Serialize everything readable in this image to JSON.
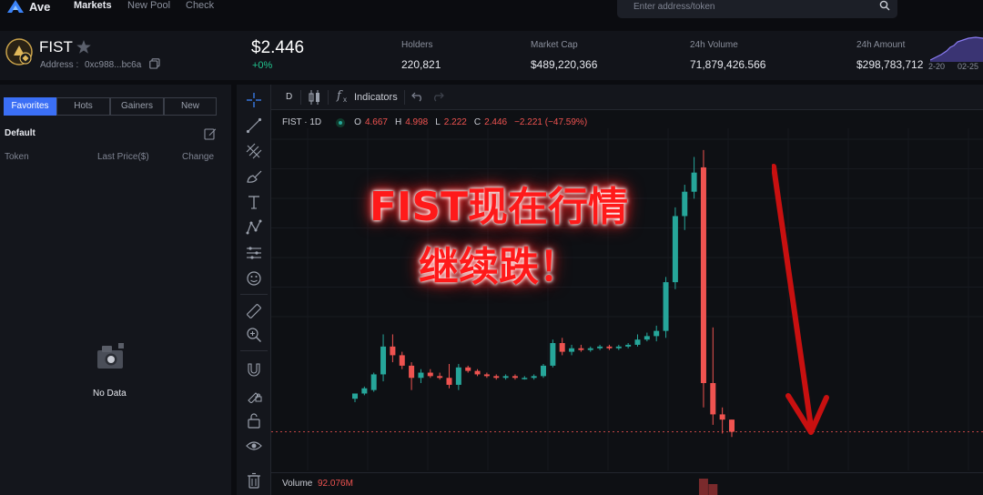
{
  "nav": {
    "logo": "Ave",
    "links": [
      "Markets",
      "New Pool",
      "Check"
    ],
    "search_placeholder": "Enter address/token"
  },
  "token": {
    "symbol": "FIST",
    "address_label": "Address :",
    "address": "0xc988...bc6a",
    "price": "$2.446",
    "change": "+0%"
  },
  "stats": [
    {
      "label": "Holders",
      "value": "220,821"
    },
    {
      "label": "Market Cap",
      "value": "$489,220,366"
    },
    {
      "label": "24h Volume",
      "value": "71,879,426.566"
    },
    {
      "label": "24h Amount",
      "value": "$298,783,712"
    }
  ],
  "mini_chart": {
    "dates": [
      "2-20",
      "02-25"
    ]
  },
  "left_panel": {
    "tabs": [
      "Favorites",
      "Hots",
      "Gainers",
      "New"
    ],
    "active_tab": 0,
    "group": "Default",
    "columns": [
      "Token",
      "Last Price($)",
      "Change"
    ],
    "empty_text": "No Data"
  },
  "chart": {
    "interval_button": "D",
    "indicators_label": "Indicators",
    "pair": "FIST · 1D",
    "ohlc": {
      "o": "4.667",
      "h": "4.998",
      "l": "2.222",
      "c": "2.446",
      "chg": "−2.221 (−47.59%)"
    },
    "volume_label": "Volume",
    "volume_value": "92.076M",
    "annotation_line1": "FIST现在行情",
    "annotation_line2": "继续跌！",
    "colors": {
      "up": "#26a69a",
      "down": "#ef5350",
      "annotation": "#ff1a1a",
      "arrow": "#d11414"
    }
  },
  "chart_data": {
    "type": "candlestick",
    "title": "",
    "series": [
      {
        "o": 0.25,
        "h": 0.28,
        "l": 0.23,
        "c": 0.28
      },
      {
        "o": 0.28,
        "h": 0.32,
        "l": 0.27,
        "c": 0.31
      },
      {
        "o": 0.3,
        "h": 0.4,
        "l": 0.29,
        "c": 0.39
      },
      {
        "o": 0.39,
        "h": 0.62,
        "l": 0.35,
        "c": 0.55
      },
      {
        "o": 0.55,
        "h": 0.62,
        "l": 0.46,
        "c": 0.5
      },
      {
        "o": 0.5,
        "h": 0.52,
        "l": 0.42,
        "c": 0.44
      },
      {
        "o": 0.44,
        "h": 0.46,
        "l": 0.3,
        "c": 0.37
      },
      {
        "o": 0.37,
        "h": 0.42,
        "l": 0.34,
        "c": 0.4
      },
      {
        "o": 0.4,
        "h": 0.42,
        "l": 0.37,
        "c": 0.38
      },
      {
        "o": 0.38,
        "h": 0.4,
        "l": 0.36,
        "c": 0.37
      },
      {
        "o": 0.37,
        "h": 0.45,
        "l": 0.31,
        "c": 0.33
      },
      {
        "o": 0.33,
        "h": 0.45,
        "l": 0.3,
        "c": 0.43
      },
      {
        "o": 0.43,
        "h": 0.44,
        "l": 0.4,
        "c": 0.41
      },
      {
        "o": 0.41,
        "h": 0.42,
        "l": 0.38,
        "c": 0.39
      },
      {
        "o": 0.39,
        "h": 0.4,
        "l": 0.37,
        "c": 0.38
      },
      {
        "o": 0.38,
        "h": 0.39,
        "l": 0.36,
        "c": 0.37
      },
      {
        "o": 0.37,
        "h": 0.39,
        "l": 0.36,
        "c": 0.38
      },
      {
        "o": 0.38,
        "h": 0.39,
        "l": 0.36,
        "c": 0.37
      },
      {
        "o": 0.37,
        "h": 0.38,
        "l": 0.36,
        "c": 0.37
      },
      {
        "o": 0.37,
        "h": 0.39,
        "l": 0.36,
        "c": 0.38
      },
      {
        "o": 0.38,
        "h": 0.45,
        "l": 0.37,
        "c": 0.44
      },
      {
        "o": 0.44,
        "h": 0.59,
        "l": 0.43,
        "c": 0.57
      },
      {
        "o": 0.57,
        "h": 0.6,
        "l": 0.5,
        "c": 0.52
      },
      {
        "o": 0.52,
        "h": 0.56,
        "l": 0.5,
        "c": 0.54
      },
      {
        "o": 0.54,
        "h": 0.56,
        "l": 0.52,
        "c": 0.53
      },
      {
        "o": 0.53,
        "h": 0.55,
        "l": 0.52,
        "c": 0.54
      },
      {
        "o": 0.54,
        "h": 0.56,
        "l": 0.53,
        "c": 0.55
      },
      {
        "o": 0.55,
        "h": 0.56,
        "l": 0.53,
        "c": 0.54
      },
      {
        "o": 0.54,
        "h": 0.56,
        "l": 0.53,
        "c": 0.55
      },
      {
        "o": 0.55,
        "h": 0.57,
        "l": 0.54,
        "c": 0.56
      },
      {
        "o": 0.56,
        "h": 0.62,
        "l": 0.55,
        "c": 0.59
      },
      {
        "o": 0.59,
        "h": 0.63,
        "l": 0.58,
        "c": 0.61
      },
      {
        "o": 0.61,
        "h": 0.67,
        "l": 0.58,
        "c": 0.64
      },
      {
        "o": 0.64,
        "h": 0.95,
        "l": 0.6,
        "c": 0.92
      },
      {
        "o": 0.92,
        "h": 1.35,
        "l": 0.88,
        "c": 1.3
      },
      {
        "o": 1.3,
        "h": 1.48,
        "l": 1.22,
        "c": 1.44
      },
      {
        "o": 1.44,
        "h": 1.64,
        "l": 1.4,
        "c": 1.55
      },
      {
        "o": 1.58,
        "h": 1.68,
        "l": 0.2,
        "c": 0.34
      },
      {
        "o": 0.34,
        "h": 0.66,
        "l": 0.1,
        "c": 0.16
      },
      {
        "o": 0.16,
        "h": 0.2,
        "l": 0.05,
        "c": 0.13
      },
      {
        "o": 0.13,
        "h": 0.13,
        "l": 0.03,
        "c": 0.06
      }
    ]
  }
}
